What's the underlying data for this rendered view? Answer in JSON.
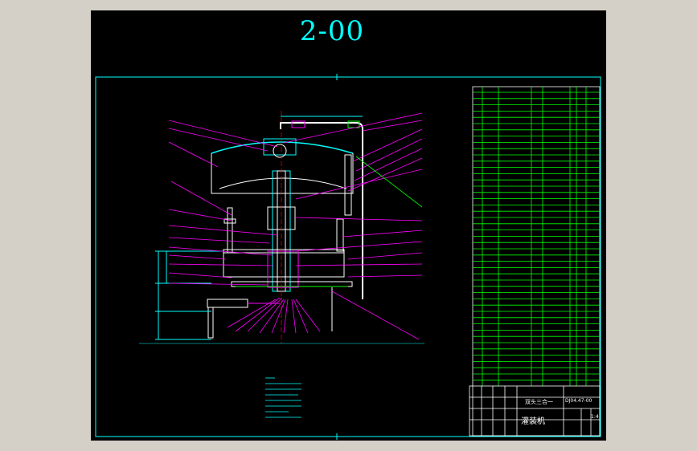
{
  "drawing": {
    "sheet_number": "2-00",
    "title_block": {
      "product_name": "灌装机",
      "drawing_code": "DJ04.47-00",
      "scale": "1:4",
      "part_name": "双头三合一"
    }
  },
  "colors": {
    "canvas_bg": "#000000",
    "frame_line": "#00ffff",
    "table_lines": "#00ff00",
    "leader_lines": "#ff00ff",
    "part_outline": "#ffffff",
    "text": "#ffffff"
  }
}
